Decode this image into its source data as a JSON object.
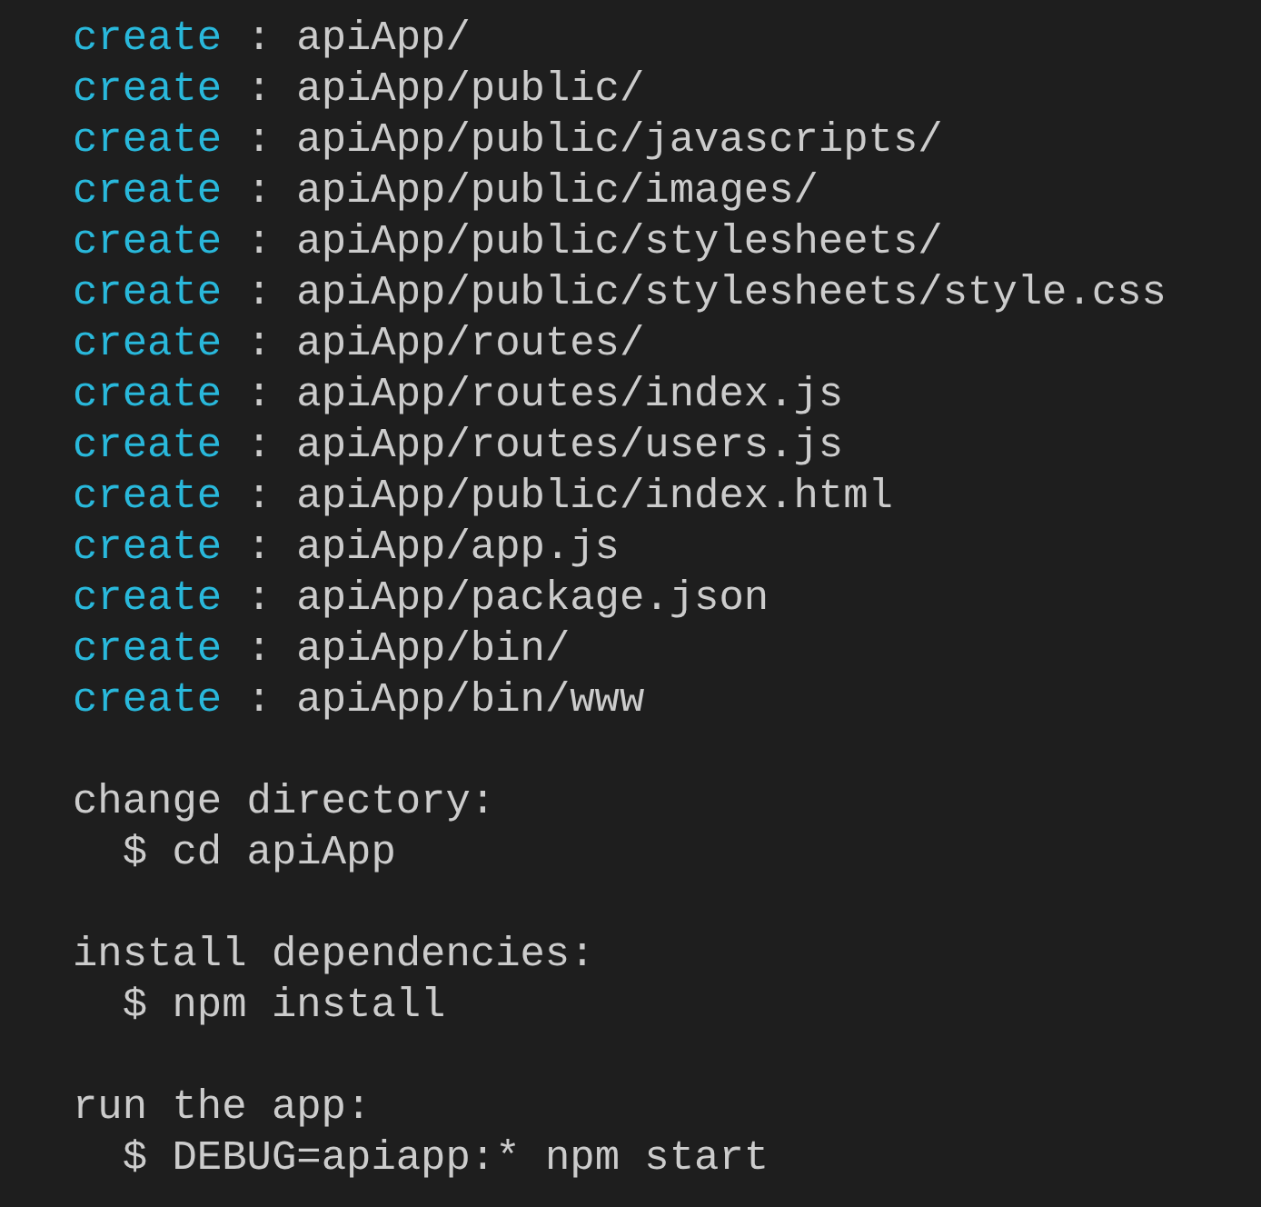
{
  "terminal": {
    "lines": [
      {
        "kind": "create",
        "keyword": "create",
        "text": ": apiApp/"
      },
      {
        "kind": "create",
        "keyword": "create",
        "text": ": apiApp/public/"
      },
      {
        "kind": "create",
        "keyword": "create",
        "text": ": apiApp/public/javascripts/"
      },
      {
        "kind": "create",
        "keyword": "create",
        "text": ": apiApp/public/images/"
      },
      {
        "kind": "create",
        "keyword": "create",
        "text": ": apiApp/public/stylesheets/"
      },
      {
        "kind": "create",
        "keyword": "create",
        "text": ": apiApp/public/stylesheets/style.css"
      },
      {
        "kind": "create",
        "keyword": "create",
        "text": ": apiApp/routes/"
      },
      {
        "kind": "create",
        "keyword": "create",
        "text": ": apiApp/routes/index.js"
      },
      {
        "kind": "create",
        "keyword": "create",
        "text": ": apiApp/routes/users.js"
      },
      {
        "kind": "create",
        "keyword": "create",
        "text": ": apiApp/public/index.html"
      },
      {
        "kind": "create",
        "keyword": "create",
        "text": ": apiApp/app.js"
      },
      {
        "kind": "create",
        "keyword": "create",
        "text": ": apiApp/package.json"
      },
      {
        "kind": "create",
        "keyword": "create",
        "text": ": apiApp/bin/"
      },
      {
        "kind": "create",
        "keyword": "create",
        "text": ": apiApp/bin/www"
      },
      {
        "kind": "blank"
      },
      {
        "kind": "heading",
        "text": "change directory:"
      },
      {
        "kind": "command",
        "text": "$ cd apiApp"
      },
      {
        "kind": "blank"
      },
      {
        "kind": "heading",
        "text": "install dependencies:"
      },
      {
        "kind": "command",
        "text": "$ npm install"
      },
      {
        "kind": "blank"
      },
      {
        "kind": "heading",
        "text": "run the app:"
      },
      {
        "kind": "command",
        "text": "$ DEBUG=apiapp:* npm start"
      }
    ]
  }
}
